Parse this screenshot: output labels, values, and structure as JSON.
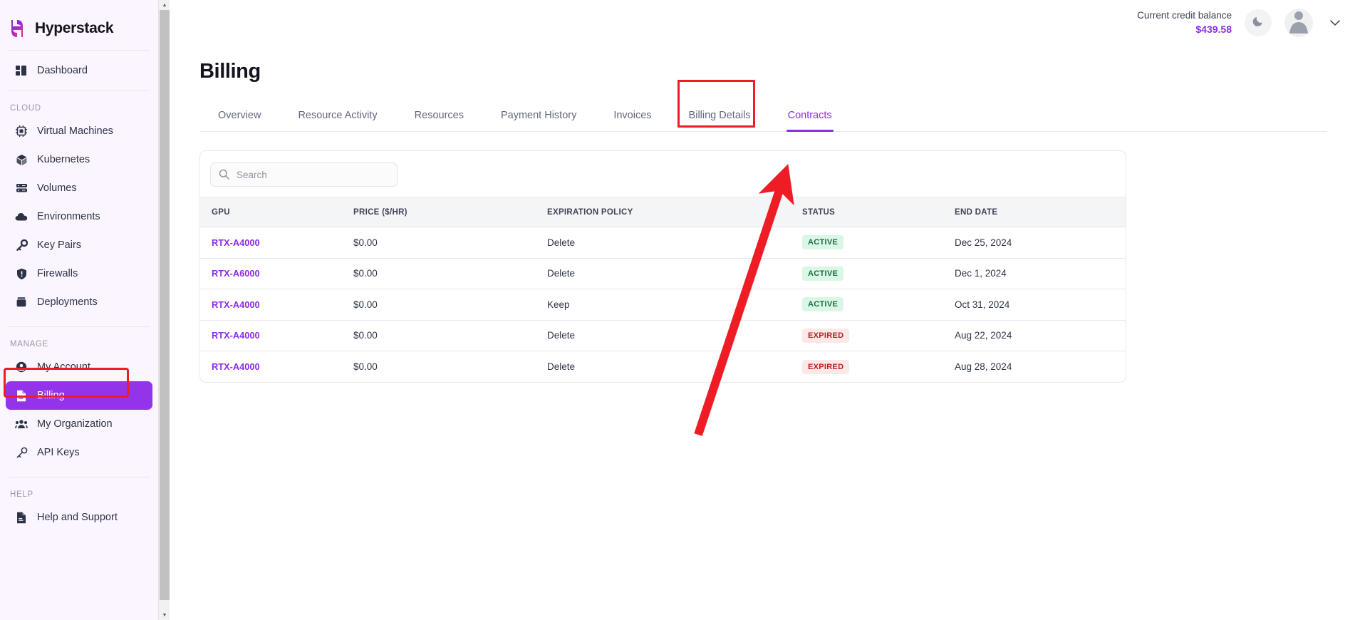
{
  "brand": {
    "name": "Hyperstack",
    "logo_icon": "hyperstack-h-logo",
    "gradient_from": "#8b2ce8",
    "gradient_to": "#d62f8f"
  },
  "sidebar": {
    "dashboard": {
      "label": "Dashboard",
      "icon": "dashboard-icon"
    },
    "groups": [
      {
        "label": "CLOUD",
        "items": [
          {
            "label": "Virtual Machines",
            "icon": "cpu-chip-icon",
            "active": false
          },
          {
            "label": "Kubernetes",
            "icon": "cube-icon",
            "active": false
          },
          {
            "label": "Volumes",
            "icon": "database-icon",
            "active": false
          },
          {
            "label": "Environments",
            "icon": "cloud-icon",
            "active": false
          },
          {
            "label": "Key Pairs",
            "icon": "key-icon",
            "active": false
          },
          {
            "label": "Firewalls",
            "icon": "shield-icon",
            "active": false
          },
          {
            "label": "Deployments",
            "icon": "deployment-box-icon",
            "active": false
          }
        ]
      },
      {
        "label": "MANAGE",
        "items": [
          {
            "label": "My Account",
            "icon": "user-circle-icon",
            "active": false
          },
          {
            "label": "Billing",
            "icon": "document-icon",
            "active": true
          },
          {
            "label": "My Organization",
            "icon": "users-group-icon",
            "active": false
          },
          {
            "label": "API Keys",
            "icon": "key-outline-icon",
            "active": false
          }
        ]
      },
      {
        "label": "HELP",
        "items": [
          {
            "label": "Help and Support",
            "icon": "document-icon",
            "active": false
          }
        ]
      }
    ],
    "active_color": "#9333ea"
  },
  "topbar": {
    "credit_label": "Current credit balance",
    "credit_value": "$439.58",
    "credit_color": "#8b2ce8",
    "theme_toggle_icon": "moon-icon",
    "avatar_icon": "user-avatar-icon",
    "account_chevron_icon": "chevron-down-icon"
  },
  "page": {
    "title": "Billing"
  },
  "tabs": [
    {
      "label": "Overview",
      "active": false
    },
    {
      "label": "Resource Activity",
      "active": false
    },
    {
      "label": "Resources",
      "active": false
    },
    {
      "label": "Payment History",
      "active": false
    },
    {
      "label": "Invoices",
      "active": false
    },
    {
      "label": "Billing Details",
      "active": false
    },
    {
      "label": "Contracts",
      "active": true
    }
  ],
  "search": {
    "value": "",
    "placeholder": "Search",
    "icon": "search-icon"
  },
  "table": {
    "columns": [
      "GPU",
      "PRICE ($/HR)",
      "EXPIRATION POLICY",
      "STATUS",
      "END DATE"
    ],
    "rows": [
      {
        "gpu": "RTX-A4000",
        "price": "$0.00",
        "policy": "Delete",
        "status": "ACTIVE",
        "end_date": "Dec 25, 2024"
      },
      {
        "gpu": "RTX-A6000",
        "price": "$0.00",
        "policy": "Delete",
        "status": "ACTIVE",
        "end_date": "Dec 1, 2024"
      },
      {
        "gpu": "RTX-A4000",
        "price": "$0.00",
        "policy": "Keep",
        "status": "ACTIVE",
        "end_date": "Oct 31, 2024"
      },
      {
        "gpu": "RTX-A4000",
        "price": "$0.00",
        "policy": "Delete",
        "status": "EXPIRED",
        "end_date": "Aug 22, 2024"
      },
      {
        "gpu": "RTX-A4000",
        "price": "$0.00",
        "policy": "Delete",
        "status": "EXPIRED",
        "end_date": "Aug 28, 2024"
      }
    ],
    "status_colors": {
      "ACTIVE": "#1d6b43",
      "EXPIRED": "#b42222"
    }
  },
  "annotations": {
    "color": "#ee1c25",
    "billing_nav_box": true,
    "contracts_tab_box": true,
    "arrow_from_table_to_contracts_tab": true
  }
}
